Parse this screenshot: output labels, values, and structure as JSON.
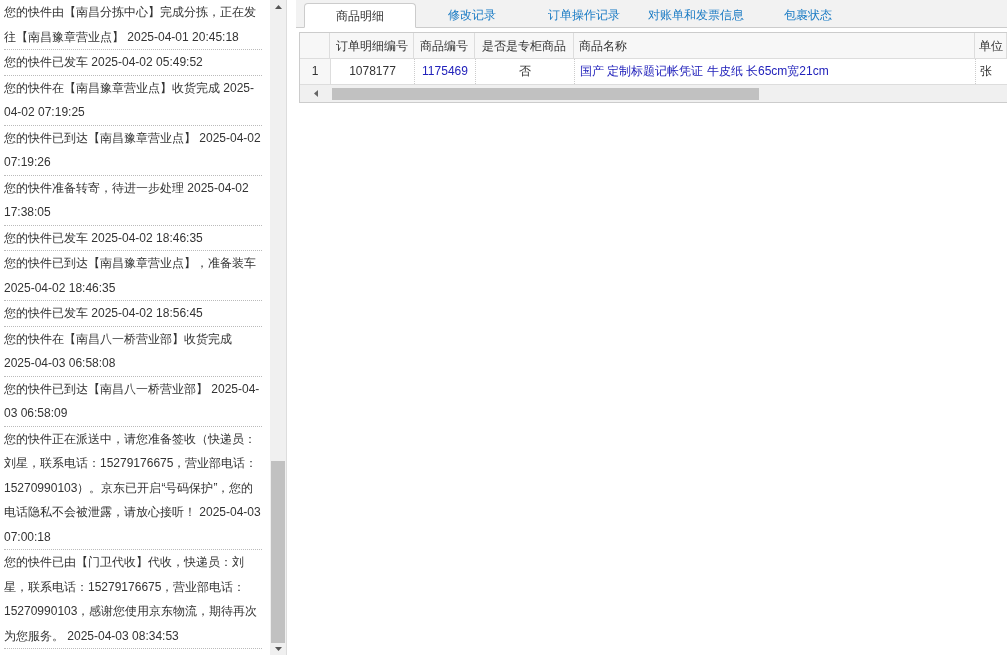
{
  "tracking_log": [
    {
      "text": "您的快件由【南昌分拣中心】完成分拣，正在发往【南昌豫章营业点】 2025-04-01 20:45:18"
    },
    {
      "text": "您的快件已发车 2025-04-02 05:49:52"
    },
    {
      "text": "您的快件在【南昌豫章营业点】收货完成 2025-04-02 07:19:25"
    },
    {
      "text": "您的快件已到达【南昌豫章营业点】 2025-04-02 07:19:26"
    },
    {
      "text": "您的快件准备转寄，待进一步处理 2025-04-02 17:38:05"
    },
    {
      "text": "您的快件已发车 2025-04-02 18:46:35"
    },
    {
      "text": "您的快件已到达【南昌豫章营业点】，准备装车 2025-04-02 18:46:35"
    },
    {
      "text": "您的快件已发车 2025-04-02 18:56:45"
    },
    {
      "text": "您的快件在【南昌八一桥营业部】收货完成 2025-04-03 06:58:08"
    },
    {
      "text": "您的快件已到达【南昌八一桥营业部】 2025-04-03 06:58:09"
    },
    {
      "text": "您的快件正在派送中，请您准备签收（快递员：刘星，联系电话：15279176675，营业部电话：15270990103）。京东已开启“号码保护”，您的电话隐私不会被泄露，请放心接听！ 2025-04-03 07:00:18"
    },
    {
      "text": "您的快件已由【门卫代收】代收，快递员：刘星，联系电话：15279176675，营业部电话：15270990103，感谢您使用京东物流，期待再次为您服务。 2025-04-03 08:34:53"
    }
  ],
  "tabs": [
    {
      "label": "商品明细",
      "selected": true
    },
    {
      "label": "修改记录",
      "selected": false
    },
    {
      "label": "订单操作记录",
      "selected": false
    },
    {
      "label": "对账单和发票信息",
      "selected": false
    },
    {
      "label": "包裹状态",
      "selected": false
    }
  ],
  "table": {
    "columns": [
      "订单明细编号",
      "商品编号",
      "是否是专柜商品",
      "商品名称",
      "单位"
    ],
    "rows": [
      {
        "row_number": "1",
        "cells": [
          "1078177",
          "1175469",
          "否",
          "国产 定制标题记帐凭证 牛皮纸 长65cm宽21cm",
          "张"
        ]
      }
    ]
  }
}
